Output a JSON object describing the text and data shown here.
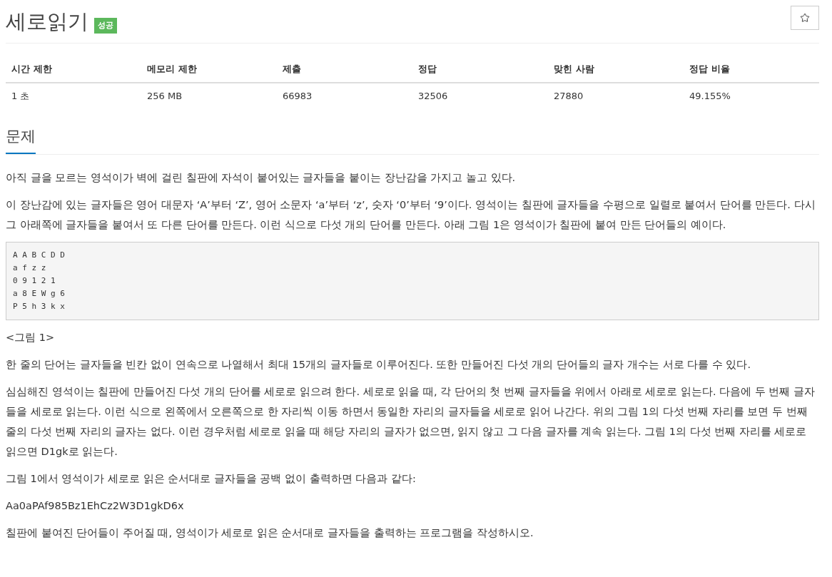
{
  "title": "세로읽기",
  "badge": "성공",
  "stats": {
    "columns": [
      "시간 제한",
      "메모리 제한",
      "제출",
      "정답",
      "맞힌 사람",
      "정답 비율"
    ],
    "row": [
      "1 초",
      "256 MB",
      "66983",
      "32506",
      "27880",
      "49.155%"
    ]
  },
  "section": "문제",
  "paragraphs_before": [
    "아직 글을 모르는 영석이가 벽에 걸린 칠판에 자석이 붙어있는 글자들을 붙이는 장난감을 가지고 놀고 있다.",
    "이 장난감에 있는 글자들은 영어 대문자 ‘A’부터 ‘Z’, 영어 소문자 ‘a’부터 ‘z’, 숫자 ‘0’부터 ‘9’이다. 영석이는 칠판에 글자들을 수평으로 일렬로 붙여서 단어를 만든다. 다시 그 아래쪽에 글자들을 붙여서 또 다른 단어를 만든다. 이런 식으로 다섯 개의 단어를 만든다. 아래 그림 1은 영석이가 칠판에 붙여 만든 단어들의 예이다."
  ],
  "code": [
    "A A B C D D",
    "a f z z",
    "0 9 1 2 1",
    "a 8 E W g 6",
    "P 5 h 3 k x"
  ],
  "paragraphs_after": [
    "<그림 1>",
    "한 줄의 단어는 글자들을 빈칸 없이 연속으로 나열해서 최대 15개의 글자들로 이루어진다. 또한 만들어진 다섯 개의 단어들의 글자 개수는 서로 다를 수 있다.",
    "심심해진 영석이는 칠판에 만들어진 다섯 개의 단어를 세로로 읽으려 한다. 세로로 읽을 때, 각 단어의 첫 번째 글자들을 위에서 아래로 세로로 읽는다. 다음에 두 번째 글자들을 세로로 읽는다. 이런 식으로 왼쪽에서 오른쪽으로 한 자리씩 이동 하면서 동일한 자리의 글자들을 세로로 읽어 나간다. 위의 그림 1의 다섯 번째 자리를 보면 두 번째 줄의 다섯 번째 자리의 글자는 없다. 이런 경우처럼 세로로 읽을 때 해당 자리의 글자가 없으면, 읽지 않고 그 다음 글자를 계속 읽는다. 그림 1의 다섯 번째 자리를 세로로 읽으면 D1gk로 읽는다.",
    "그림 1에서 영석이가 세로로 읽은 순서대로 글자들을 공백 없이 출력하면 다음과 같다:",
    "Aa0aPAf985Bz1EhCz2W3D1gkD6x",
    "칠판에 붙여진 단어들이 주어질 때, 영석이가 세로로 읽은 순서대로 글자들을 출력하는 프로그램을 작성하시오."
  ]
}
